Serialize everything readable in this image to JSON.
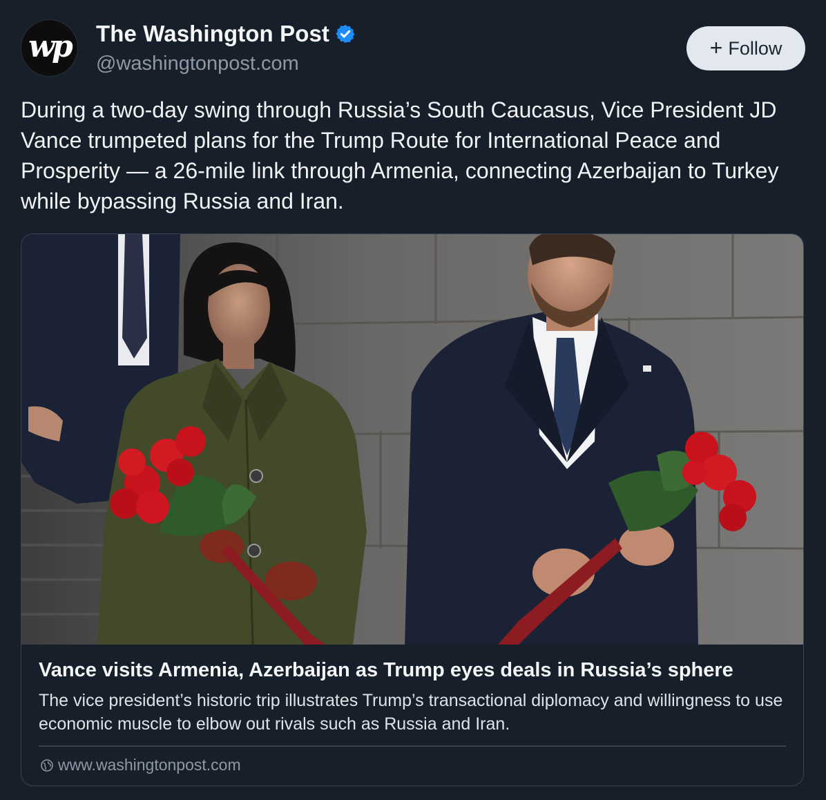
{
  "author": {
    "avatar_glyph": "wp",
    "display_name": "The Washington Post",
    "verified": true,
    "handle": "@washingtonpost.com"
  },
  "follow_button": {
    "icon": "plus-icon",
    "label": "Follow"
  },
  "post": {
    "text": "During a two-day swing through Russia’s South Caucasus, Vice President JD Vance trumpeted plans for the Trump Route for International Peace and Prosperity — a 26-mile link through Armenia, connecting Azerbaijan to Turkey while bypassing Russia and Iran."
  },
  "link_card": {
    "title": "Vance visits Armenia, Azerbaijan as Trump eyes deals in Russia’s sphere",
    "description": "The vice president’s historic trip illustrates Trump’s transactional diplomacy and willingness to use economic muscle to elbow out rivals such as Russia and Iran.",
    "domain_icon": "globe-icon",
    "domain": "www.washingtonpost.com"
  },
  "colors": {
    "background": "#171f2a",
    "verified_blue": "#1d8cf8",
    "follow_bg": "#e3e8ef",
    "rose_red": "#c8121c",
    "coat_green": "#434a2a",
    "suit_navy": "#1c2235"
  }
}
